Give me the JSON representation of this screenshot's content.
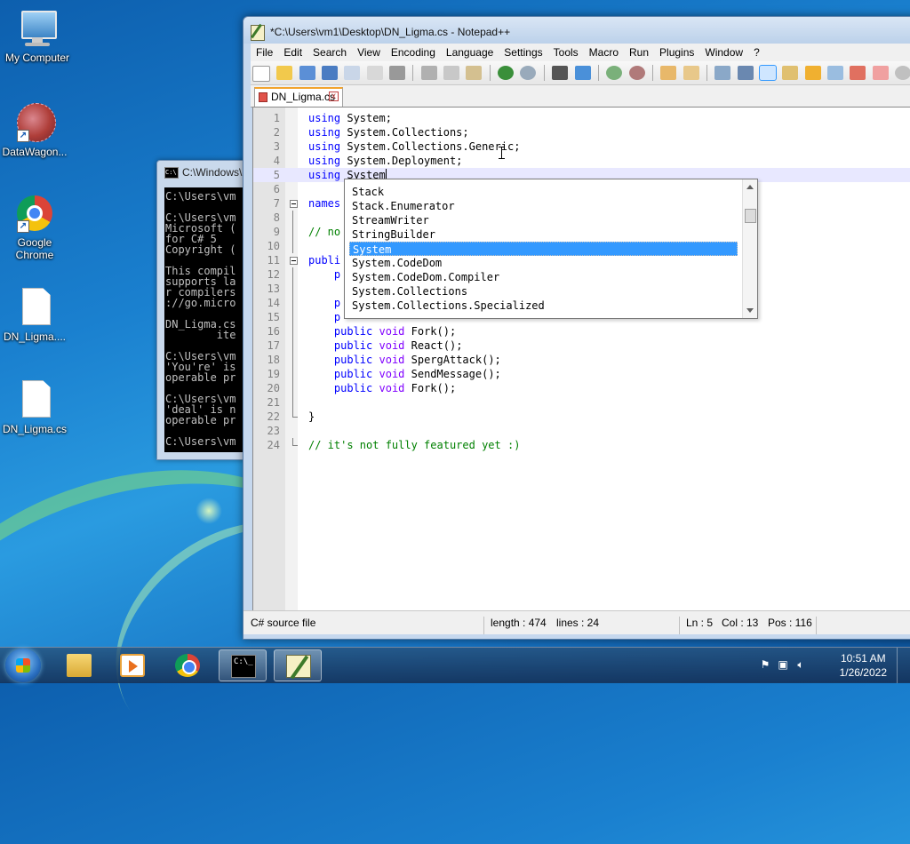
{
  "desktop": {
    "icons": [
      {
        "label": "My Computer",
        "icon": "computer-icon"
      },
      {
        "label": "DataWagon...",
        "icon": "datawagon-icon"
      },
      {
        "label": "Google Chrome",
        "icon": "chrome-icon"
      },
      {
        "label": "DN_Ligma....",
        "icon": "file-icon"
      },
      {
        "label": "DN_Ligma.cs",
        "icon": "file-icon"
      }
    ]
  },
  "cmd": {
    "title": "C:\\Windows\\",
    "lines": [
      "C:\\Users\\vm",
      "",
      "C:\\Users\\vm",
      "Microsoft (",
      "for C# 5",
      "Copyright (",
      "",
      "This compil",
      "supports la",
      "r compilers",
      "://go.micro",
      "",
      "DN_Ligma.cs",
      "        ite",
      "",
      "C:\\Users\\vm",
      "'You're' is",
      "operable pr",
      "",
      "C:\\Users\\vm",
      "'deal' is n",
      "operable pr",
      "",
      "C:\\Users\\vm"
    ]
  },
  "npp": {
    "title": "*C:\\Users\\vm1\\Desktop\\DN_Ligma.cs - Notepad++",
    "menu": [
      "File",
      "Edit",
      "Search",
      "View",
      "Encoding",
      "Language",
      "Settings",
      "Tools",
      "Macro",
      "Run",
      "Plugins",
      "Window",
      "?"
    ],
    "tab": "DN_Ligma.cs",
    "tab_close": "x",
    "autocomplete": {
      "items": [
        "Stack",
        "Stack.Enumerator",
        "StreamWriter",
        "StringBuilder",
        "System",
        "System.CodeDom",
        "System.CodeDom.Compiler",
        "System.Collections",
        "System.Collections.Specialized"
      ],
      "selected_index": 4
    },
    "status": {
      "file_type": "C# source file",
      "length": "length : 474",
      "lines": "lines : 24",
      "ln": "Ln : 5",
      "col": "Col : 13",
      "pos": "Pos : 116"
    }
  },
  "taskbar": {
    "apps": [
      "explorer-icon",
      "media-player-icon",
      "chrome-icon",
      "cmd-icon",
      "notepadpp-icon"
    ],
    "tray_icons": [
      "action-center-icon",
      "network-icon",
      "volume-icon"
    ],
    "time": "10:51 AM",
    "date": "1/26/2022"
  }
}
